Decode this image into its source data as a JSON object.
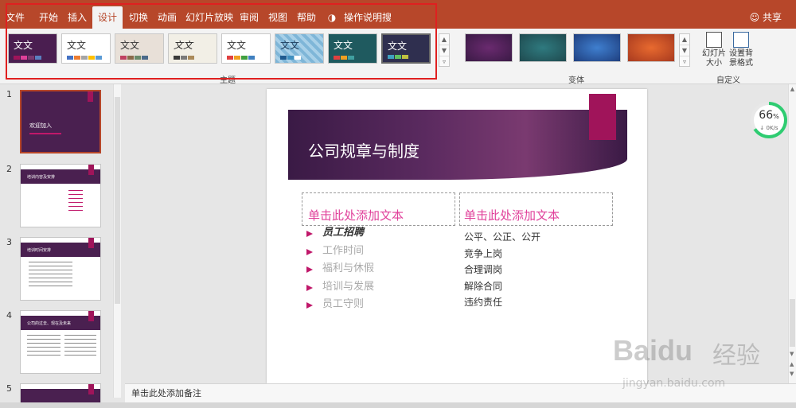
{
  "ribbon": {
    "tabs": [
      "文件",
      "开始",
      "插入",
      "设计",
      "切换",
      "动画",
      "幻灯片放映",
      "审阅",
      "视图",
      "帮助",
      "操作说明搜索"
    ],
    "active_tab": "设计",
    "share_label": "共享",
    "themes": [
      {
        "label": "文文",
        "bg": "#4a1e50",
        "fg": "#ffffff"
      },
      {
        "label": "文文",
        "bg": "#ffffff",
        "fg": "#333333"
      },
      {
        "label": "文文",
        "bg": "#e8e0d8",
        "fg": "#333333"
      },
      {
        "label": "文文",
        "bg": "#f2efe6",
        "fg": "#222222"
      },
      {
        "label": "文文",
        "bg": "#ffffff",
        "fg": "#333333"
      },
      {
        "label": "文文",
        "bg": "#7fb6d8",
        "fg": "#1a3a5a"
      },
      {
        "label": "文文",
        "bg": "#1f5a5f",
        "fg": "#ffffff"
      },
      {
        "label": "文文",
        "bg": "#2f2f4f",
        "fg": "#ffffff"
      }
    ],
    "themes_group_label": "主题",
    "variants": [
      {
        "bg": "#4a1e50"
      },
      {
        "bg": "#1f5a5f"
      },
      {
        "bg": "#1f4f8f"
      },
      {
        "bg": "#c84a1f"
      }
    ],
    "variants_group_label": "变体",
    "custom_buttons": [
      {
        "label": "幻灯片大小"
      },
      {
        "label": "设置背景格式"
      }
    ],
    "custom_group_label": "自定义"
  },
  "slides_panel": {
    "items": [
      {
        "num": "1",
        "title": "欢迎加入"
      },
      {
        "num": "2",
        "title": "培训内容及安排"
      },
      {
        "num": "3",
        "title": "培训时间安排"
      },
      {
        "num": "4",
        "title": "公司的过去、现在及未来"
      },
      {
        "num": "5",
        "title": ""
      }
    ]
  },
  "slide": {
    "title": "公司规章与制度",
    "left_placeholder": "单击此处添加文本",
    "right_placeholder": "单击此处添加文本",
    "left_bullets": [
      "员工招聘",
      "工作时间",
      "福利与休假",
      "培训与发展",
      "员工守则"
    ],
    "right_items": [
      "公平、公正、公开",
      "竞争上岗",
      "合理调岗",
      "解除合同",
      "违约责任"
    ]
  },
  "notes_placeholder": "单击此处添加备注",
  "progress": {
    "percent": "66",
    "unit": "%",
    "speed": "0K/s",
    "fraction": 0.66
  },
  "watermark": {
    "brand": "Baidu",
    "cn": "经验",
    "url": "jingyan.baidu.com"
  },
  "colors": {
    "accent": "#b7472a",
    "highlight": "#e02020",
    "placeholder_pink": "#e0409a",
    "bullet": "#c0186a"
  }
}
